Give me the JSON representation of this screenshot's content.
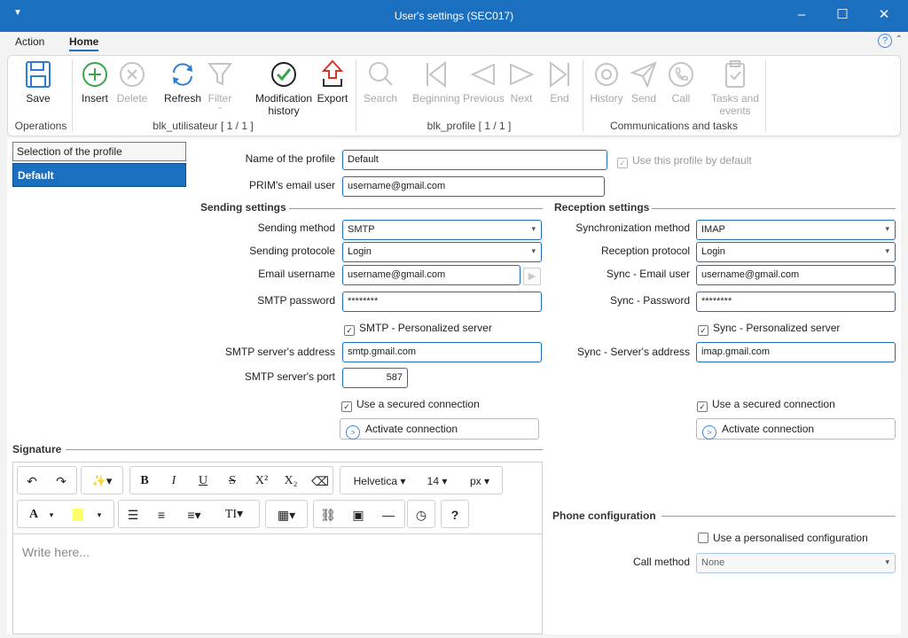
{
  "window": {
    "title": "User's settings (SEC017)"
  },
  "tabs": [
    {
      "label": "Action"
    },
    {
      "label": "Home"
    }
  ],
  "ribbon": {
    "buttons": {
      "save": "Save",
      "insert": "Insert",
      "delete": "Delete",
      "refresh": "Refresh",
      "filter": "Filter",
      "modification_history_line1": "Modification",
      "modification_history_line2": "history",
      "export": "Export",
      "search": "Search",
      "beginning": "Beginning",
      "previous": "Previous",
      "next": "Next",
      "end": "End",
      "history": "History",
      "send": "Send",
      "call": "Call",
      "tasks_line1": "Tasks and",
      "tasks_line2": "events"
    },
    "groups": {
      "operations": "Operations",
      "blk_utilisateur": "blk_utilisateur [ 1 / 1 ]",
      "blk_profile": "blk_profile [ 1 / 1 ]",
      "communications": "Communications and tasks"
    }
  },
  "profiles": {
    "header": "Selection of the profile",
    "selected": "Default"
  },
  "profile": {
    "name_label": "Name of the profile",
    "name_value": "Default",
    "default_checkbox": "Use this profile by default",
    "prim_email_label": "PRIM's email user",
    "prim_email_value": "username@gmail.com"
  },
  "sending": {
    "title": "Sending settings",
    "method_label": "Sending method",
    "method_value": "SMTP",
    "protocol_label": "Sending protocole",
    "protocol_value": "Login",
    "email_label": "Email username",
    "email_value": "username@gmail.com",
    "password_label": "SMTP password",
    "password_value": "********",
    "personalized_checkbox": "SMTP - Personalized server",
    "server_label": "SMTP server's address",
    "server_value": "smtp.gmail.com",
    "port_label": "SMTP server's port",
    "port_value": "587",
    "secured_checkbox": "Use a secured connection",
    "activate_button": "Activate connection"
  },
  "reception": {
    "title": "Reception settings",
    "method_label": "Synchronization method",
    "method_value": "IMAP",
    "protocol_label": "Reception protocol",
    "protocol_value": "Login",
    "email_label": "Sync - Email user",
    "email_value": "username@gmail.com",
    "password_label": "Sync - Password",
    "password_value": "********",
    "personalized_checkbox": "Sync - Personalized server",
    "server_label": "Sync - Server's address",
    "server_value": "imap.gmail.com",
    "secured_checkbox": "Use a secured connection",
    "activate_button": "Activate connection"
  },
  "signature": {
    "title": "Signature",
    "font": "Helvetica",
    "size": "14",
    "unit": "px",
    "placeholder": "Write here..."
  },
  "phone": {
    "title": "Phone configuration",
    "personalised_checkbox": "Use a personalised configuration",
    "call_method_label": "Call method",
    "call_method_value": "None"
  },
  "colors": {
    "accent": "#1a6fbf",
    "highlight_swatch": "#ffff66"
  }
}
